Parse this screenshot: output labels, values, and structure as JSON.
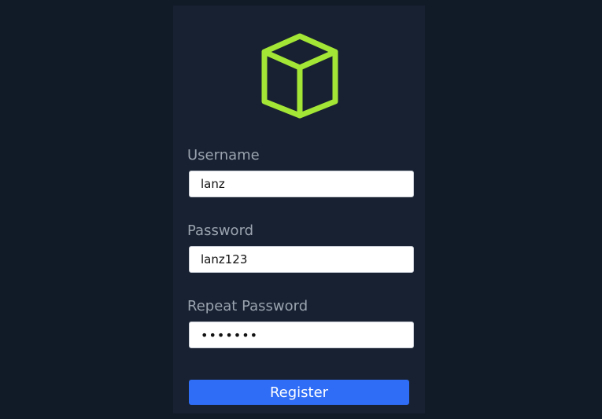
{
  "colors": {
    "background": "#111a27",
    "card": "#182131",
    "logo": "#a3e635",
    "label": "#9aa3af",
    "button": "#2f6df6"
  },
  "logo": {
    "icon": "cube-icon"
  },
  "form": {
    "username": {
      "label": "Username",
      "value": "lanz"
    },
    "password": {
      "label": "Password",
      "value": "lanz123"
    },
    "repeat_password": {
      "label": "Repeat Password",
      "value": "lanz123"
    },
    "register_label": "Register"
  }
}
